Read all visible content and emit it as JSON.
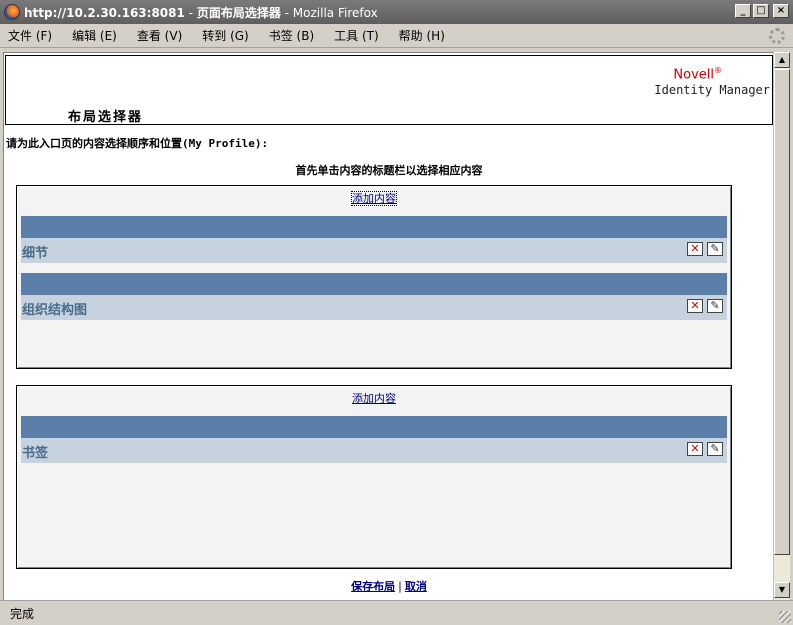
{
  "window": {
    "url": "http://10.2.30.163:8081",
    "separator": " - ",
    "page_title": "页面布局选择器",
    "app_name": "Mozilla Firefox",
    "min_glyph": "_",
    "max_glyph": "□",
    "close_glyph": "×"
  },
  "menu": {
    "items": [
      "文件 (F)",
      "编辑 (E)",
      "查看 (V)",
      "转到 (G)",
      "书签 (B)",
      "工具 (T)",
      "帮助 (H)"
    ]
  },
  "header": {
    "brand": "Novell",
    "brand_mark": "®",
    "product": "Identity Manager",
    "heading": "布局选择器"
  },
  "instructions": {
    "main": "请为此入口页的内容选择顺序和位置(My Profile):",
    "sub": "首先单击内容的标题栏以选择相应内容"
  },
  "containers": [
    {
      "add_label": "添加内容",
      "portlets": [
        {
          "name": "细节"
        },
        {
          "name": "组织结构图"
        }
      ]
    },
    {
      "add_label": "添加内容",
      "portlets": [
        {
          "name": "书签"
        }
      ]
    }
  ],
  "actions": {
    "delete_glyph": "✕",
    "edit_glyph": "✎"
  },
  "footer": {
    "save": "保存布局",
    "separator": "|",
    "cancel": "取消"
  },
  "status": {
    "text": "完成"
  },
  "colors": {
    "portlet_bar": "#5b7fa8",
    "portlet_row": "#c6d3df",
    "brand": "#cc0000"
  }
}
